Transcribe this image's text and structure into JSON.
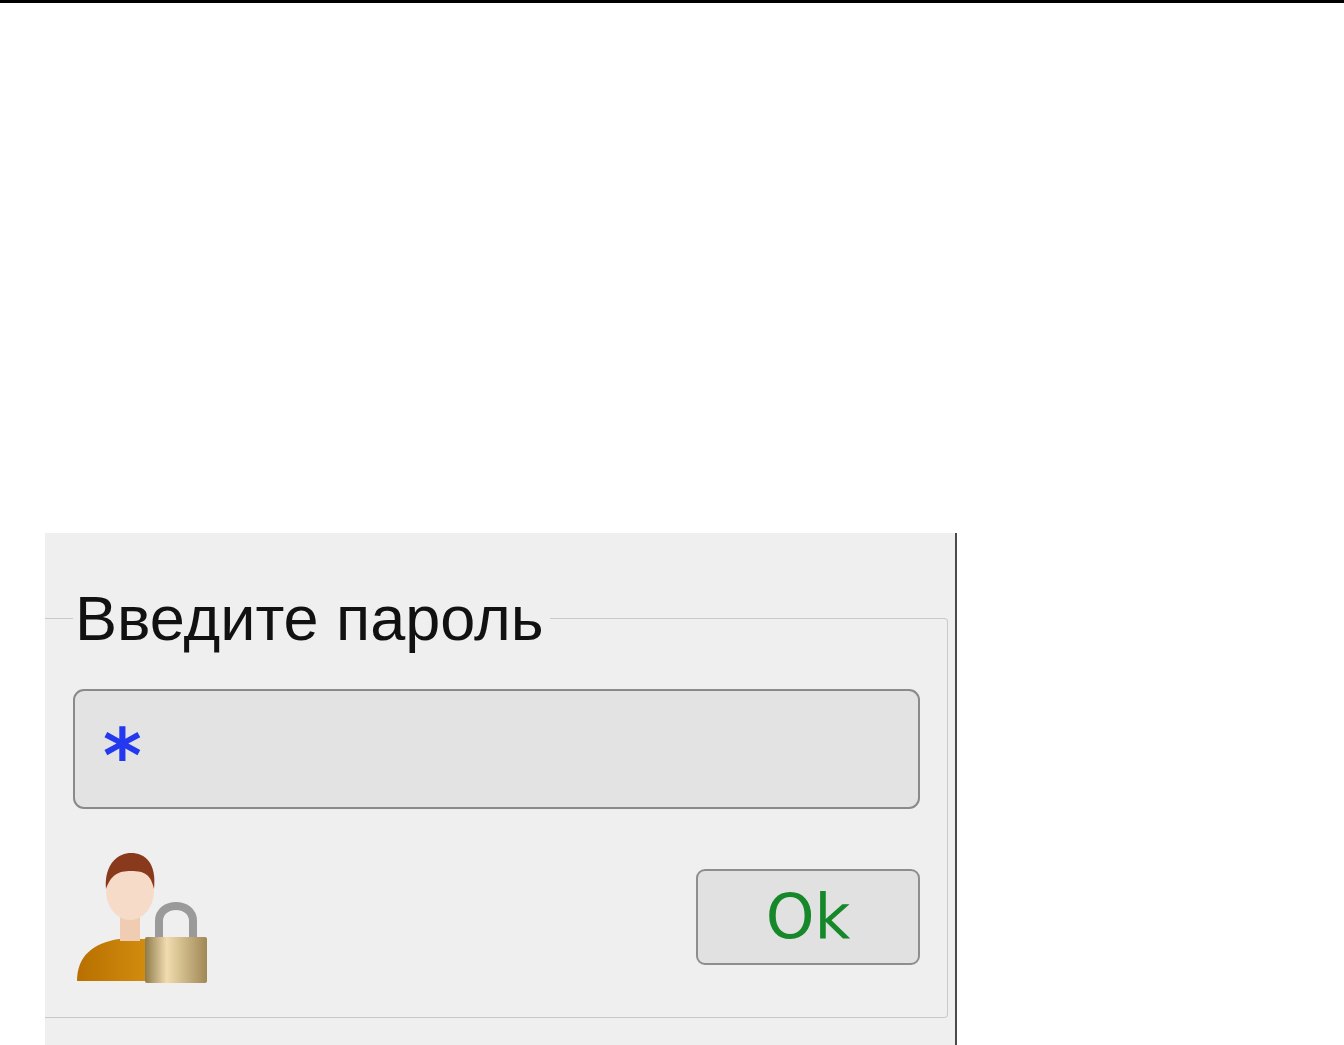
{
  "group": {
    "title": "Введите пароль"
  },
  "password_field": {
    "value": "*"
  },
  "buttons": [
    {
      "label": "Ok"
    }
  ]
}
